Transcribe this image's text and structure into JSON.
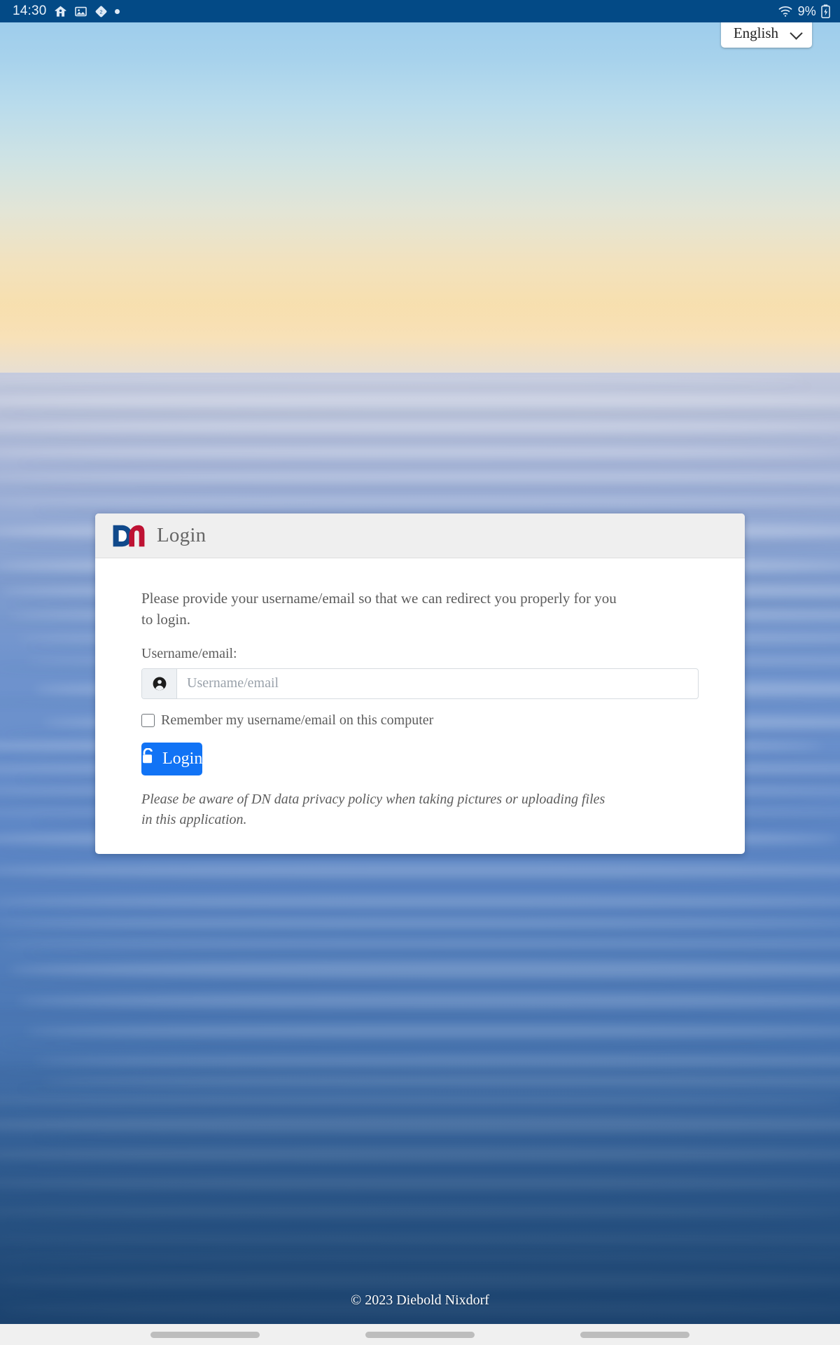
{
  "statusbar": {
    "clock": "14:30",
    "icons_left": [
      "family-link-icon",
      "image-icon",
      "badge-icon",
      "dot-indicator-icon"
    ],
    "wifi_icon": "wifi-icon",
    "battery_percent": "9%",
    "battery_icon": "battery-charging-icon",
    "background_color": "#034a86"
  },
  "language_selector": {
    "selected": "English",
    "chevron_icon": "chevron-down-icon"
  },
  "card": {
    "logo_icon": "dn-logo-icon",
    "title": "Login",
    "intro": "Please provide your username/email so that we can redirect you properly for you to login.",
    "field_label": "Username/email:",
    "input": {
      "icon": "user-account-icon",
      "value": "",
      "placeholder": "Username/email"
    },
    "remember": {
      "label": "Remember my username/email on this computer",
      "checked": false
    },
    "login_button": {
      "label": "Login",
      "icon": "unlock-icon",
      "color": "#1173f5"
    },
    "privacy_note": "Please be aware of DN data privacy policy when taking pictures or uploading files in this application."
  },
  "footer": {
    "copyright": "© 2023 Diebold Nixdorf"
  },
  "navbar": {
    "pills": [
      "nav-pill-left",
      "nav-pill-center",
      "nav-pill-right"
    ]
  },
  "brand": {
    "logo_blue": "#10498b",
    "logo_red": "#be1233"
  }
}
